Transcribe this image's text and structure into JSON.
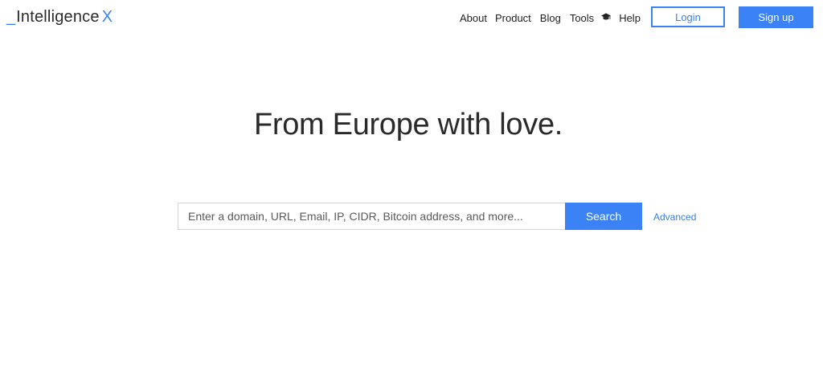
{
  "header": {
    "logo": {
      "underscore": "_",
      "word": "Intelligence",
      "x": "X"
    },
    "nav": {
      "about": "About",
      "product": "Product",
      "blog": "Blog",
      "tools": "Tools",
      "academy_icon": "graduation-cap-icon",
      "help": "Help"
    },
    "login_label": "Login",
    "signup_label": "Sign up"
  },
  "hero": {
    "title": "From Europe with love."
  },
  "search": {
    "placeholder": "Enter a domain, URL, Email, IP, CIDR, Bitcoin address, and more...",
    "value": "",
    "button_label": "Search",
    "advanced_label": "Advanced"
  },
  "colors": {
    "accent": "#3b82f6",
    "text": "#2a2a2a",
    "border": "#d6d6d6"
  }
}
